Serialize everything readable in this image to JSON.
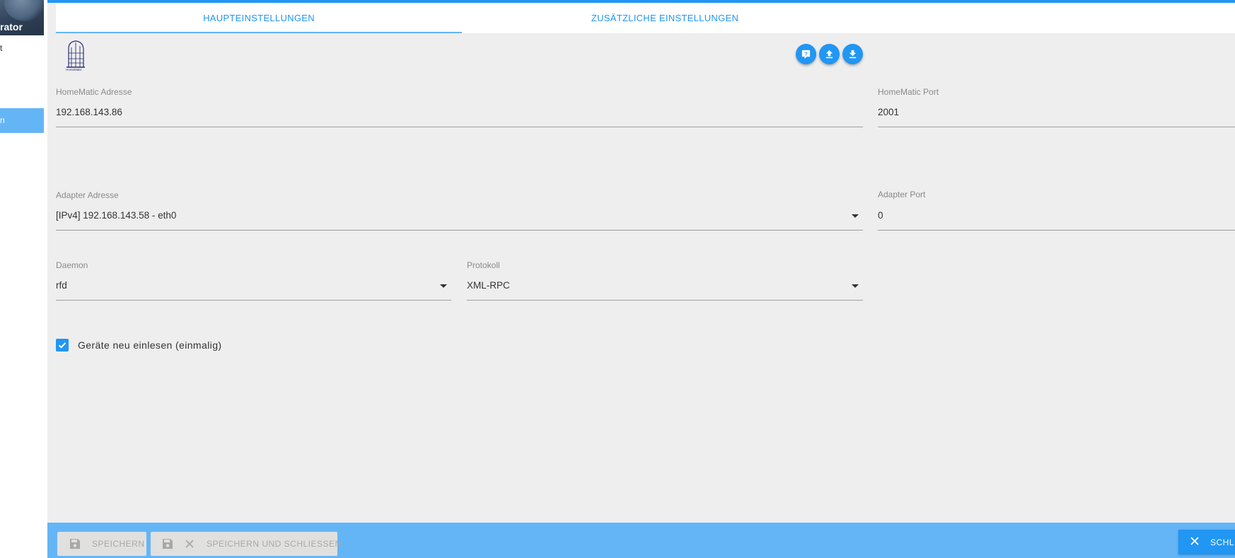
{
  "sidebar": {
    "user_label": "rator",
    "items": [
      {
        "label": "t",
        "active": false
      },
      {
        "label": "n",
        "active": true
      }
    ]
  },
  "tabs": [
    {
      "label": "HAUPTEINSTELLUNGEN",
      "active": true
    },
    {
      "label": "ZUSÄTZLICHE EINSTELLUNGEN",
      "active": false
    }
  ],
  "logo": {
    "text": "HomeMatic"
  },
  "toolbar": {
    "icons": [
      "help-icon",
      "upload-icon",
      "download-icon"
    ]
  },
  "form": {
    "homematic_address": {
      "label": "HomeMatic Adresse",
      "value": "192.168.143.86"
    },
    "homematic_port": {
      "label": "HomeMatic Port",
      "value": "2001"
    },
    "adapter_address": {
      "label": "Adapter Adresse",
      "value": "[IPv4] 192.168.143.58 - eth0"
    },
    "adapter_port": {
      "label": "Adapter Port",
      "value": "0"
    },
    "daemon": {
      "label": "Daemon",
      "value": "rfd"
    },
    "protocol": {
      "label": "Protokoll",
      "value": "XML-RPC"
    },
    "reread_devices": {
      "label": "Geräte neu einlesen (einmalig)",
      "checked": true
    }
  },
  "footer": {
    "save_label": "SPEICHERN",
    "save_close_label": "SPEICHERN UND SCHLIESSEN",
    "close_label": "SCHL"
  },
  "colors": {
    "accent": "#2196f3",
    "accent_light": "#64b5f6",
    "panel_bg": "#eeeeee"
  }
}
